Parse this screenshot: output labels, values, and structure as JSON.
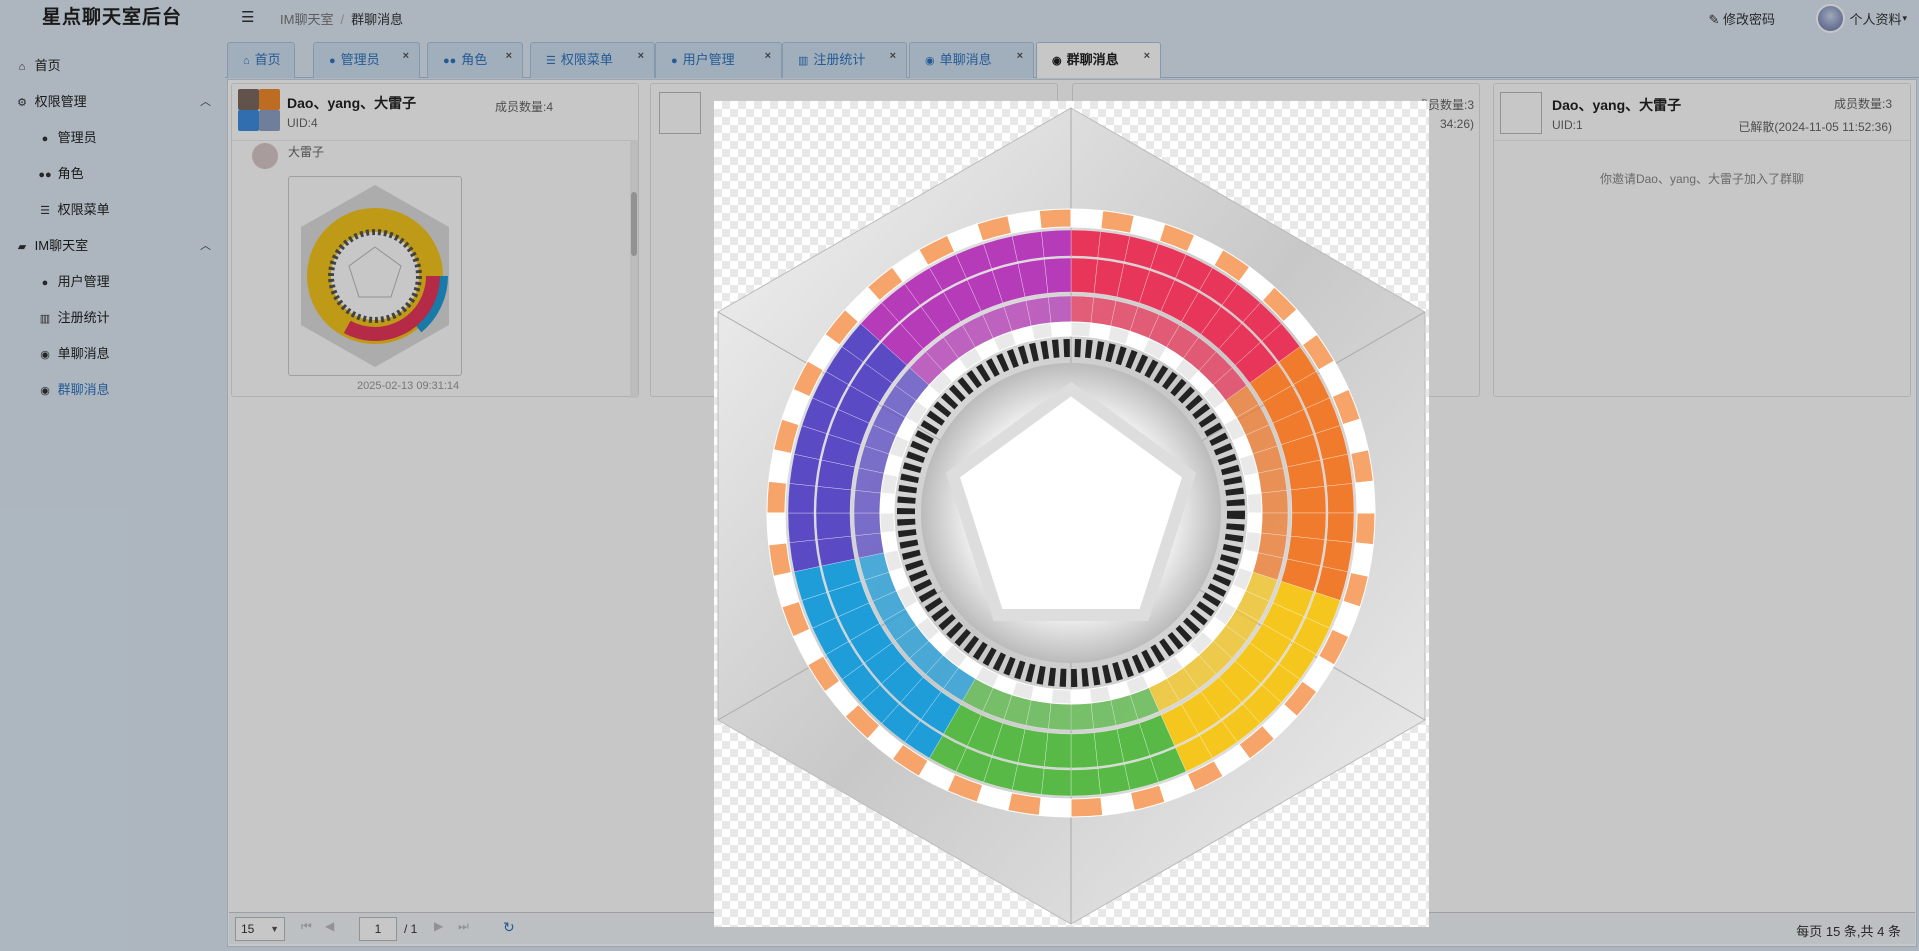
{
  "app": {
    "title": "星点聊天室后台"
  },
  "topbar": {
    "breadcrumb": [
      "IM聊天室",
      "群聊消息"
    ],
    "change_password": "修改密码",
    "profile": "个人资料"
  },
  "sidebar": {
    "items": [
      {
        "label": "首页",
        "icon": "home-icon"
      },
      {
        "label": "权限管理",
        "icon": "gear-icon"
      },
      {
        "label": "管理员",
        "icon": "user-icon"
      },
      {
        "label": "角色",
        "icon": "users-icon"
      },
      {
        "label": "权限菜单",
        "icon": "list-icon"
      },
      {
        "label": "IM聊天室",
        "icon": "comments-icon"
      },
      {
        "label": "用户管理",
        "icon": "user-icon"
      },
      {
        "label": "注册统计",
        "icon": "bar-chart-icon"
      },
      {
        "label": "单聊消息",
        "icon": "comment-icon"
      },
      {
        "label": "群聊消息",
        "icon": "comment-dots-icon"
      }
    ]
  },
  "tabs": [
    {
      "label": "首页",
      "icon": "home-icon"
    },
    {
      "label": "管理员",
      "icon": "user-icon"
    },
    {
      "label": "角色",
      "icon": "users-icon"
    },
    {
      "label": "权限菜单",
      "icon": "list-icon"
    },
    {
      "label": "用户管理",
      "icon": "user-icon"
    },
    {
      "label": "注册统计",
      "icon": "bar-chart-icon"
    },
    {
      "label": "单聊消息",
      "icon": "comment-icon"
    },
    {
      "label": "群聊消息",
      "icon": "comment-dots-icon"
    }
  ],
  "groups": [
    {
      "name": "Dao、yang、大雷子",
      "uid": "UID:4",
      "members": "成员数量:4",
      "sender": "大雷子",
      "message_time": "2025-02-13 09:31:14"
    },
    {
      "members": "成员数量:3",
      "status_partial": "34:26)"
    },
    {
      "name": "Dao、yang、大雷子",
      "uid": "UID:1",
      "members": "成员数量:3",
      "status": "已解散(2024-11-05 11:52:36)",
      "system_message": "你邀请Dao、yang、大雷子加入了群聊"
    }
  ],
  "pager": {
    "page_size": "15",
    "page": "1",
    "total_pages": "/ 1",
    "info": "每页 15 条,共 4 条"
  },
  "preview": {
    "alt": "bagua-wheel-image",
    "colors": [
      "#e8365a",
      "#f07b2d",
      "#f5c61e",
      "#59b947",
      "#1f9dd9",
      "#5a4bc4",
      "#b63bb8"
    ]
  }
}
